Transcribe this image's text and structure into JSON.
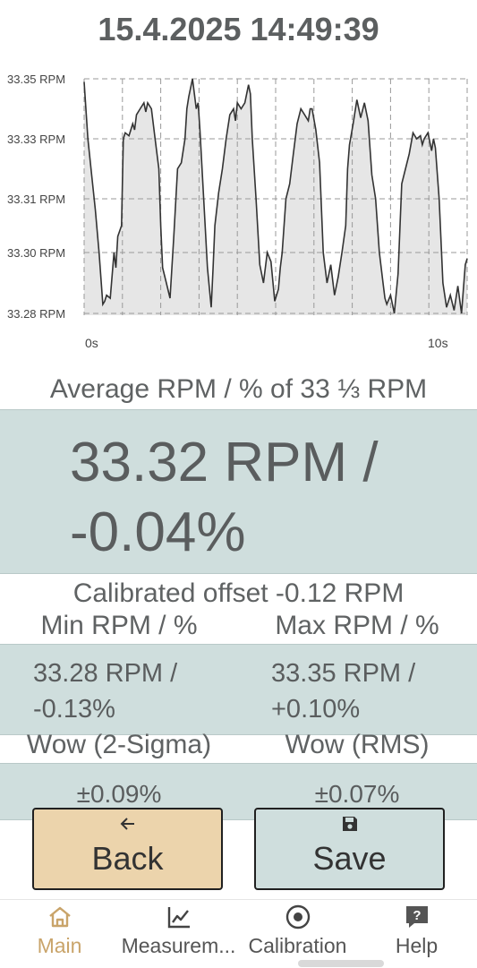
{
  "datetime": "15.4.2025 14:49:39",
  "chart_data": {
    "type": "area",
    "yticks": [
      33.35,
      33.33,
      33.31,
      33.3,
      33.28
    ],
    "ytick_labels": [
      "33.35 RPM",
      "33.33 RPM",
      "33.31 RPM",
      "33.30 RPM",
      "33.28 RPM"
    ],
    "xtick_labels": [
      "0s",
      "10s"
    ],
    "xlim": [
      0,
      10
    ],
    "grid": true,
    "colors": {
      "line": "#333333",
      "fill": "#e6e6e6",
      "grid": "#999999"
    },
    "x": [
      0,
      0.1,
      0.2,
      0.3,
      0.4,
      0.5,
      0.55,
      0.6,
      0.7,
      0.8,
      0.85,
      0.9,
      1.0,
      1.05,
      1.1,
      1.2,
      1.3,
      1.35,
      1.4,
      1.5,
      1.6,
      1.65,
      1.7,
      1.8,
      1.9,
      2.0,
      2.05,
      2.1,
      2.2,
      2.3,
      2.4,
      2.5,
      2.6,
      2.7,
      2.75,
      2.8,
      2.9,
      3.0,
      3.05,
      3.1,
      3.2,
      3.3,
      3.4,
      3.45,
      3.5,
      3.6,
      3.7,
      3.8,
      3.9,
      4.0,
      4.05,
      4.1,
      4.2,
      4.3,
      4.4,
      4.45,
      4.5,
      4.6,
      4.7,
      4.8,
      4.9,
      5.0,
      5.1,
      5.2,
      5.25,
      5.3,
      5.4,
      5.5,
      5.6,
      5.65,
      5.7,
      5.8,
      5.9,
      6.0,
      6.05,
      6.1,
      6.2,
      6.3,
      6.4,
      6.5,
      6.6,
      6.7,
      6.8,
      6.9,
      7.0,
      7.05,
      7.1,
      7.2,
      7.3,
      7.4,
      7.5,
      7.6,
      7.7,
      7.8,
      7.9,
      8.0,
      8.05,
      8.1,
      8.2,
      8.3,
      8.4,
      8.5,
      8.6,
      8.7,
      8.8,
      8.9,
      9.0,
      9.05,
      9.1,
      9.2,
      9.3,
      9.35,
      9.4,
      9.5,
      9.6,
      9.7,
      9.8,
      9.9,
      10.0,
      10.1,
      10.2,
      10.25
    ],
    "values": [
      33.349,
      33.33,
      33.318,
      33.308,
      33.3,
      33.283,
      33.284,
      33.286,
      33.285,
      33.3,
      33.295,
      33.303,
      33.305,
      33.33,
      33.332,
      33.331,
      33.335,
      33.333,
      33.338,
      33.34,
      33.342,
      33.339,
      33.342,
      33.34,
      33.33,
      33.32,
      33.305,
      33.295,
      33.29,
      33.285,
      33.303,
      33.32,
      33.322,
      33.33,
      33.34,
      33.344,
      33.35,
      33.34,
      33.342,
      33.333,
      33.31,
      33.295,
      33.282,
      33.295,
      33.305,
      33.312,
      33.32,
      33.33,
      33.338,
      33.34,
      33.336,
      33.342,
      33.34,
      33.342,
      33.348,
      33.345,
      33.33,
      33.31,
      33.296,
      33.29,
      33.3,
      33.297,
      33.284,
      33.288,
      33.295,
      33.3,
      33.31,
      33.315,
      33.325,
      33.33,
      33.335,
      33.34,
      33.338,
      33.336,
      33.34,
      33.34,
      33.333,
      33.322,
      33.3,
      33.29,
      33.296,
      33.286,
      33.292,
      33.3,
      33.305,
      33.32,
      33.328,
      33.335,
      33.343,
      33.337,
      33.342,
      33.336,
      33.318,
      33.31,
      33.3,
      33.29,
      33.285,
      33.283,
      33.286,
      33.28,
      33.293,
      33.315,
      33.32,
      33.325,
      33.332,
      33.33,
      33.331,
      33.328,
      33.33,
      33.332,
      33.326,
      33.33,
      33.327,
      33.31,
      33.29,
      33.282,
      33.286,
      33.281,
      33.289,
      33.28,
      33.296,
      33.298
    ]
  },
  "average_title": "Average RPM / % of 33 ⅓ RPM",
  "average_value": "33.32 RPM / -0.04%",
  "calibrated_offset": "Calibrated offset  -0.12 RPM",
  "min_title": "Min RPM / %",
  "max_title": "Max RPM / %",
  "min_value": [
    "33.28 RPM /",
    "-0.13%"
  ],
  "max_value": [
    "33.35 RPM /",
    "+0.10%"
  ],
  "wow_2sigma_title": "Wow (2-Sigma)",
  "wow_rms_title": "Wow (RMS)",
  "wow_2sigma_value": "±0.09%",
  "wow_rms_value": "±0.07%",
  "buttons": {
    "back_label": "Back",
    "back_icon": "arrow-left-icon",
    "back_color": "#ecd4ac",
    "save_label": "Save",
    "save_icon": "floppy-disk-icon",
    "save_color": "#cfdedd"
  },
  "nav": {
    "items": [
      {
        "label": "Main",
        "icon": "home-icon",
        "active": true
      },
      {
        "label": "Measurem...",
        "icon": "line-chart-icon",
        "active": false
      },
      {
        "label": "Calibration",
        "icon": "target-icon",
        "active": false
      },
      {
        "label": "Help",
        "icon": "help-icon",
        "active": false
      }
    ],
    "active_color": "#c9a46a"
  }
}
